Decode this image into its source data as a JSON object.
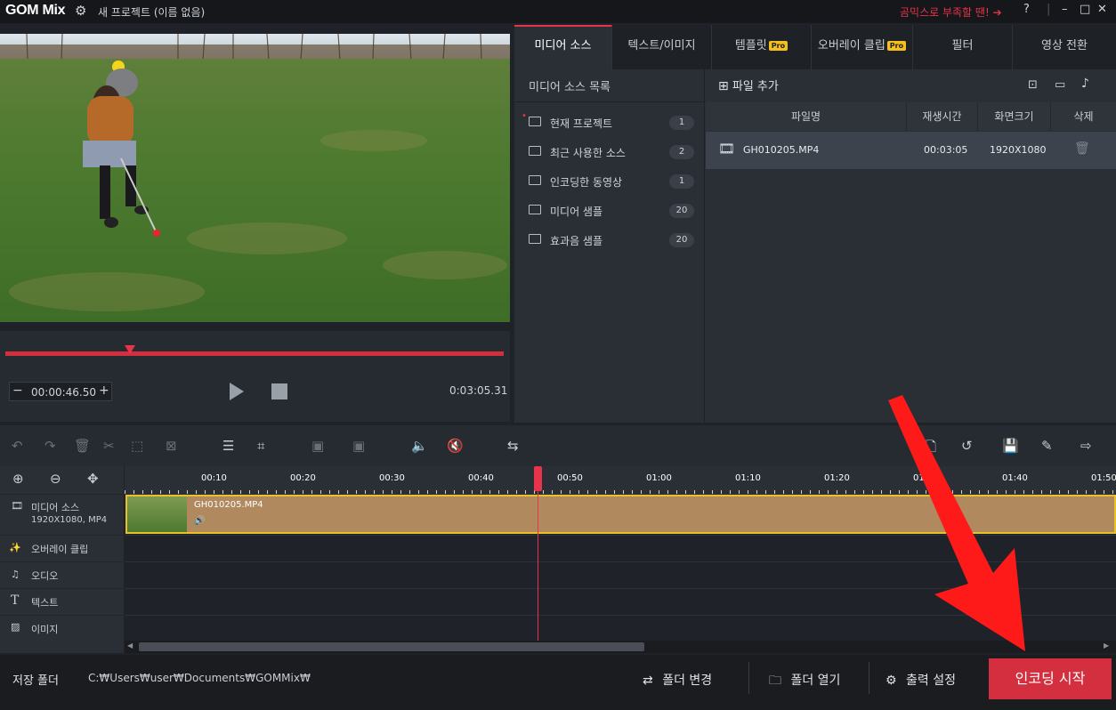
{
  "titlebar": {
    "logo": "GOM Mix",
    "project_title": "새 프로젝트 (이름 없음)",
    "promo": "곰믹스로 부족할 땐!",
    "help": "?",
    "minimize": "–",
    "maximize": "□",
    "close": "✕"
  },
  "player": {
    "current_time": "00:00:46.50",
    "total_time": "0:03:05.31",
    "progress": 0.25
  },
  "tabs": [
    {
      "label": "미디어 소스",
      "pro": false
    },
    {
      "label": "텍스트/이미지",
      "pro": false
    },
    {
      "label": "템플릿",
      "pro": true
    },
    {
      "label": "오버레이 클립",
      "pro": true
    },
    {
      "label": "필터",
      "pro": false
    },
    {
      "label": "영상 전환",
      "pro": false
    }
  ],
  "pro_badge": "Pro",
  "source_list": {
    "header": "미디어 소스 목록",
    "items": [
      {
        "label": "현재 프로젝트",
        "count": "1"
      },
      {
        "label": "최근 사용한 소스",
        "count": "2"
      },
      {
        "label": "인코딩한 동영상",
        "count": "1"
      },
      {
        "label": "미디어 샘플",
        "count": "20"
      },
      {
        "label": "효과음 샘플",
        "count": "20"
      }
    ]
  },
  "file_pane": {
    "add_file": "파일 추가",
    "columns": [
      "파일명",
      "재생시간",
      "화면크기",
      "삭제"
    ],
    "rows": [
      {
        "name": "GH010205.MP4",
        "duration": "00:03:05",
        "size": "1920X1080"
      }
    ]
  },
  "timeline": {
    "ruler": [
      "00:10",
      "00:20",
      "00:30",
      "00:40",
      "00:50",
      "01:00",
      "01:10",
      "01:20",
      "01:30",
      "01:40",
      "01:50"
    ],
    "tracks": {
      "media": {
        "label": "미디어 소스",
        "sub": "1920X1080, MP4"
      },
      "overlay": "오버레이 클립",
      "audio": "오디오",
      "text": "텍스트",
      "image": "이미지"
    },
    "clip_name": "GH010205.MP4"
  },
  "bottom": {
    "save_folder_label": "저장 폴더",
    "save_path": "C:₩Users₩user₩Documents₩GOMMix₩",
    "change_folder": "폴더 변경",
    "open_folder": "폴더 열기",
    "output_settings": "출력 설정",
    "start_encoding": "인코딩 시작"
  },
  "colors": {
    "accent": "#e8334a",
    "encode_button": "#d42f3e",
    "clip": "#b08a5e",
    "clip_border": "#e9c02a",
    "pro_badge": "#f4c01e"
  }
}
